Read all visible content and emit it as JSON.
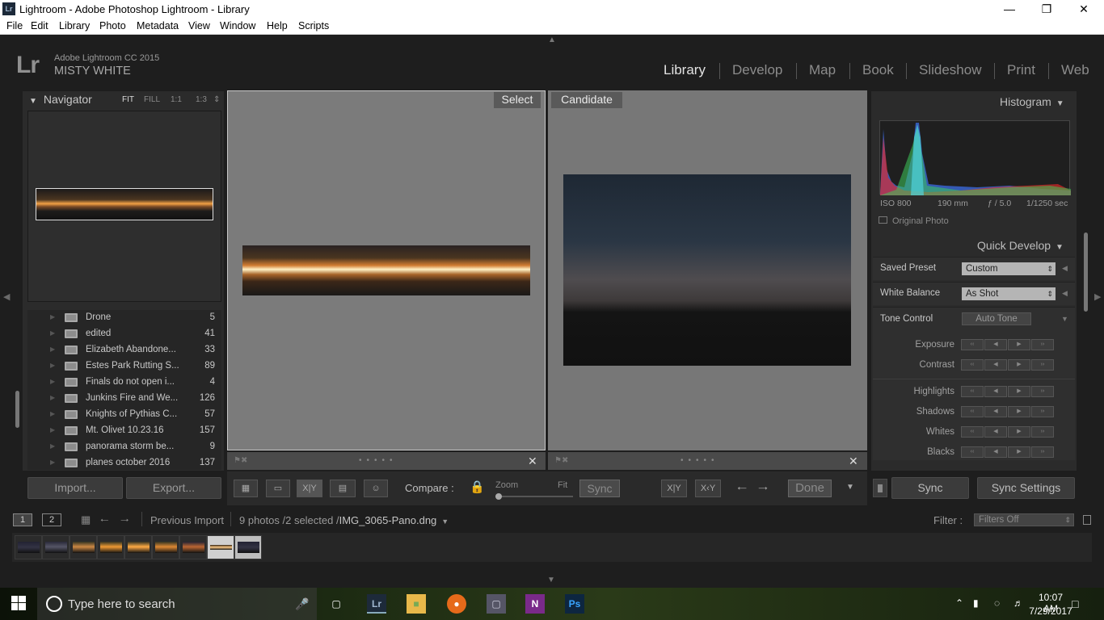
{
  "window": {
    "title": "Lightroom - Adobe Photoshop Lightroom - Library",
    "app_icon": "Lr"
  },
  "menu": [
    "File",
    "Edit",
    "Library",
    "Photo",
    "Metadata",
    "View",
    "Window",
    "Help",
    "Scripts"
  ],
  "identity": {
    "logo": "Lr",
    "version": "Adobe Lightroom CC 2015",
    "name": "MISTY WHITE"
  },
  "modules": [
    "Library",
    "Develop",
    "Map",
    "Book",
    "Slideshow",
    "Print",
    "Web"
  ],
  "active_module": "Library",
  "navigator": {
    "title": "Navigator",
    "options": [
      "FIT",
      "FILL",
      "1:1",
      "1:3"
    ]
  },
  "folders": [
    {
      "name": "Drone",
      "count": "5"
    },
    {
      "name": "edited",
      "count": "41"
    },
    {
      "name": "Elizabeth Abandone...",
      "count": "33"
    },
    {
      "name": "Estes Park Rutting S...",
      "count": "89"
    },
    {
      "name": "Finals do not open i...",
      "count": "4"
    },
    {
      "name": "Junkins Fire and We...",
      "count": "126"
    },
    {
      "name": "Knights of Pythias C...",
      "count": "57"
    },
    {
      "name": "Mt. Olivet 10.23.16",
      "count": "157"
    },
    {
      "name": "panorama storm be...",
      "count": "9"
    },
    {
      "name": "planes october 2016",
      "count": "137"
    }
  ],
  "left_buttons": {
    "import": "Import...",
    "export": "Export..."
  },
  "compare": {
    "select_label": "Select",
    "candidate_label": "Candidate"
  },
  "toolbar": {
    "compare_label": "Compare :",
    "zoom_label": "Zoom",
    "fit_label": "Fit",
    "sync": "Sync",
    "done": "Done",
    "zoom_level": 0.0
  },
  "histogram": {
    "title": "Histogram",
    "iso": "ISO 800",
    "focal": "190 mm",
    "aperture": "ƒ / 5.0",
    "shutter": "1/1250 sec",
    "original_photo": "Original Photo"
  },
  "quick_develop": {
    "title": "Quick Develop",
    "saved_preset_label": "Saved Preset",
    "saved_preset_value": "Custom",
    "wb_label": "White Balance",
    "wb_value": "As Shot",
    "tone_label": "Tone Control",
    "auto_tone": "Auto Tone",
    "rows": [
      "Exposure",
      "Contrast",
      "Highlights",
      "Shadows",
      "Whites",
      "Blacks"
    ]
  },
  "right_buttons": {
    "sync": "Sync",
    "sync_settings": "Sync Settings"
  },
  "filmbar": {
    "screen1": "1",
    "screen2": "2",
    "source": "Previous Import",
    "info_prefix": "9 photos /2 selected /",
    "filename": "IMG_3065-Pano.dng",
    "filter_label": "Filter :",
    "filter_value": "Filters Off"
  },
  "taskbar": {
    "search_placeholder": "Type here to search",
    "time": "10:07 AM",
    "date": "7/29/2017"
  },
  "colors": {
    "accent_module": "#e2e2e2",
    "panel": "#2b2b2b",
    "background": "#1e1e1e"
  }
}
